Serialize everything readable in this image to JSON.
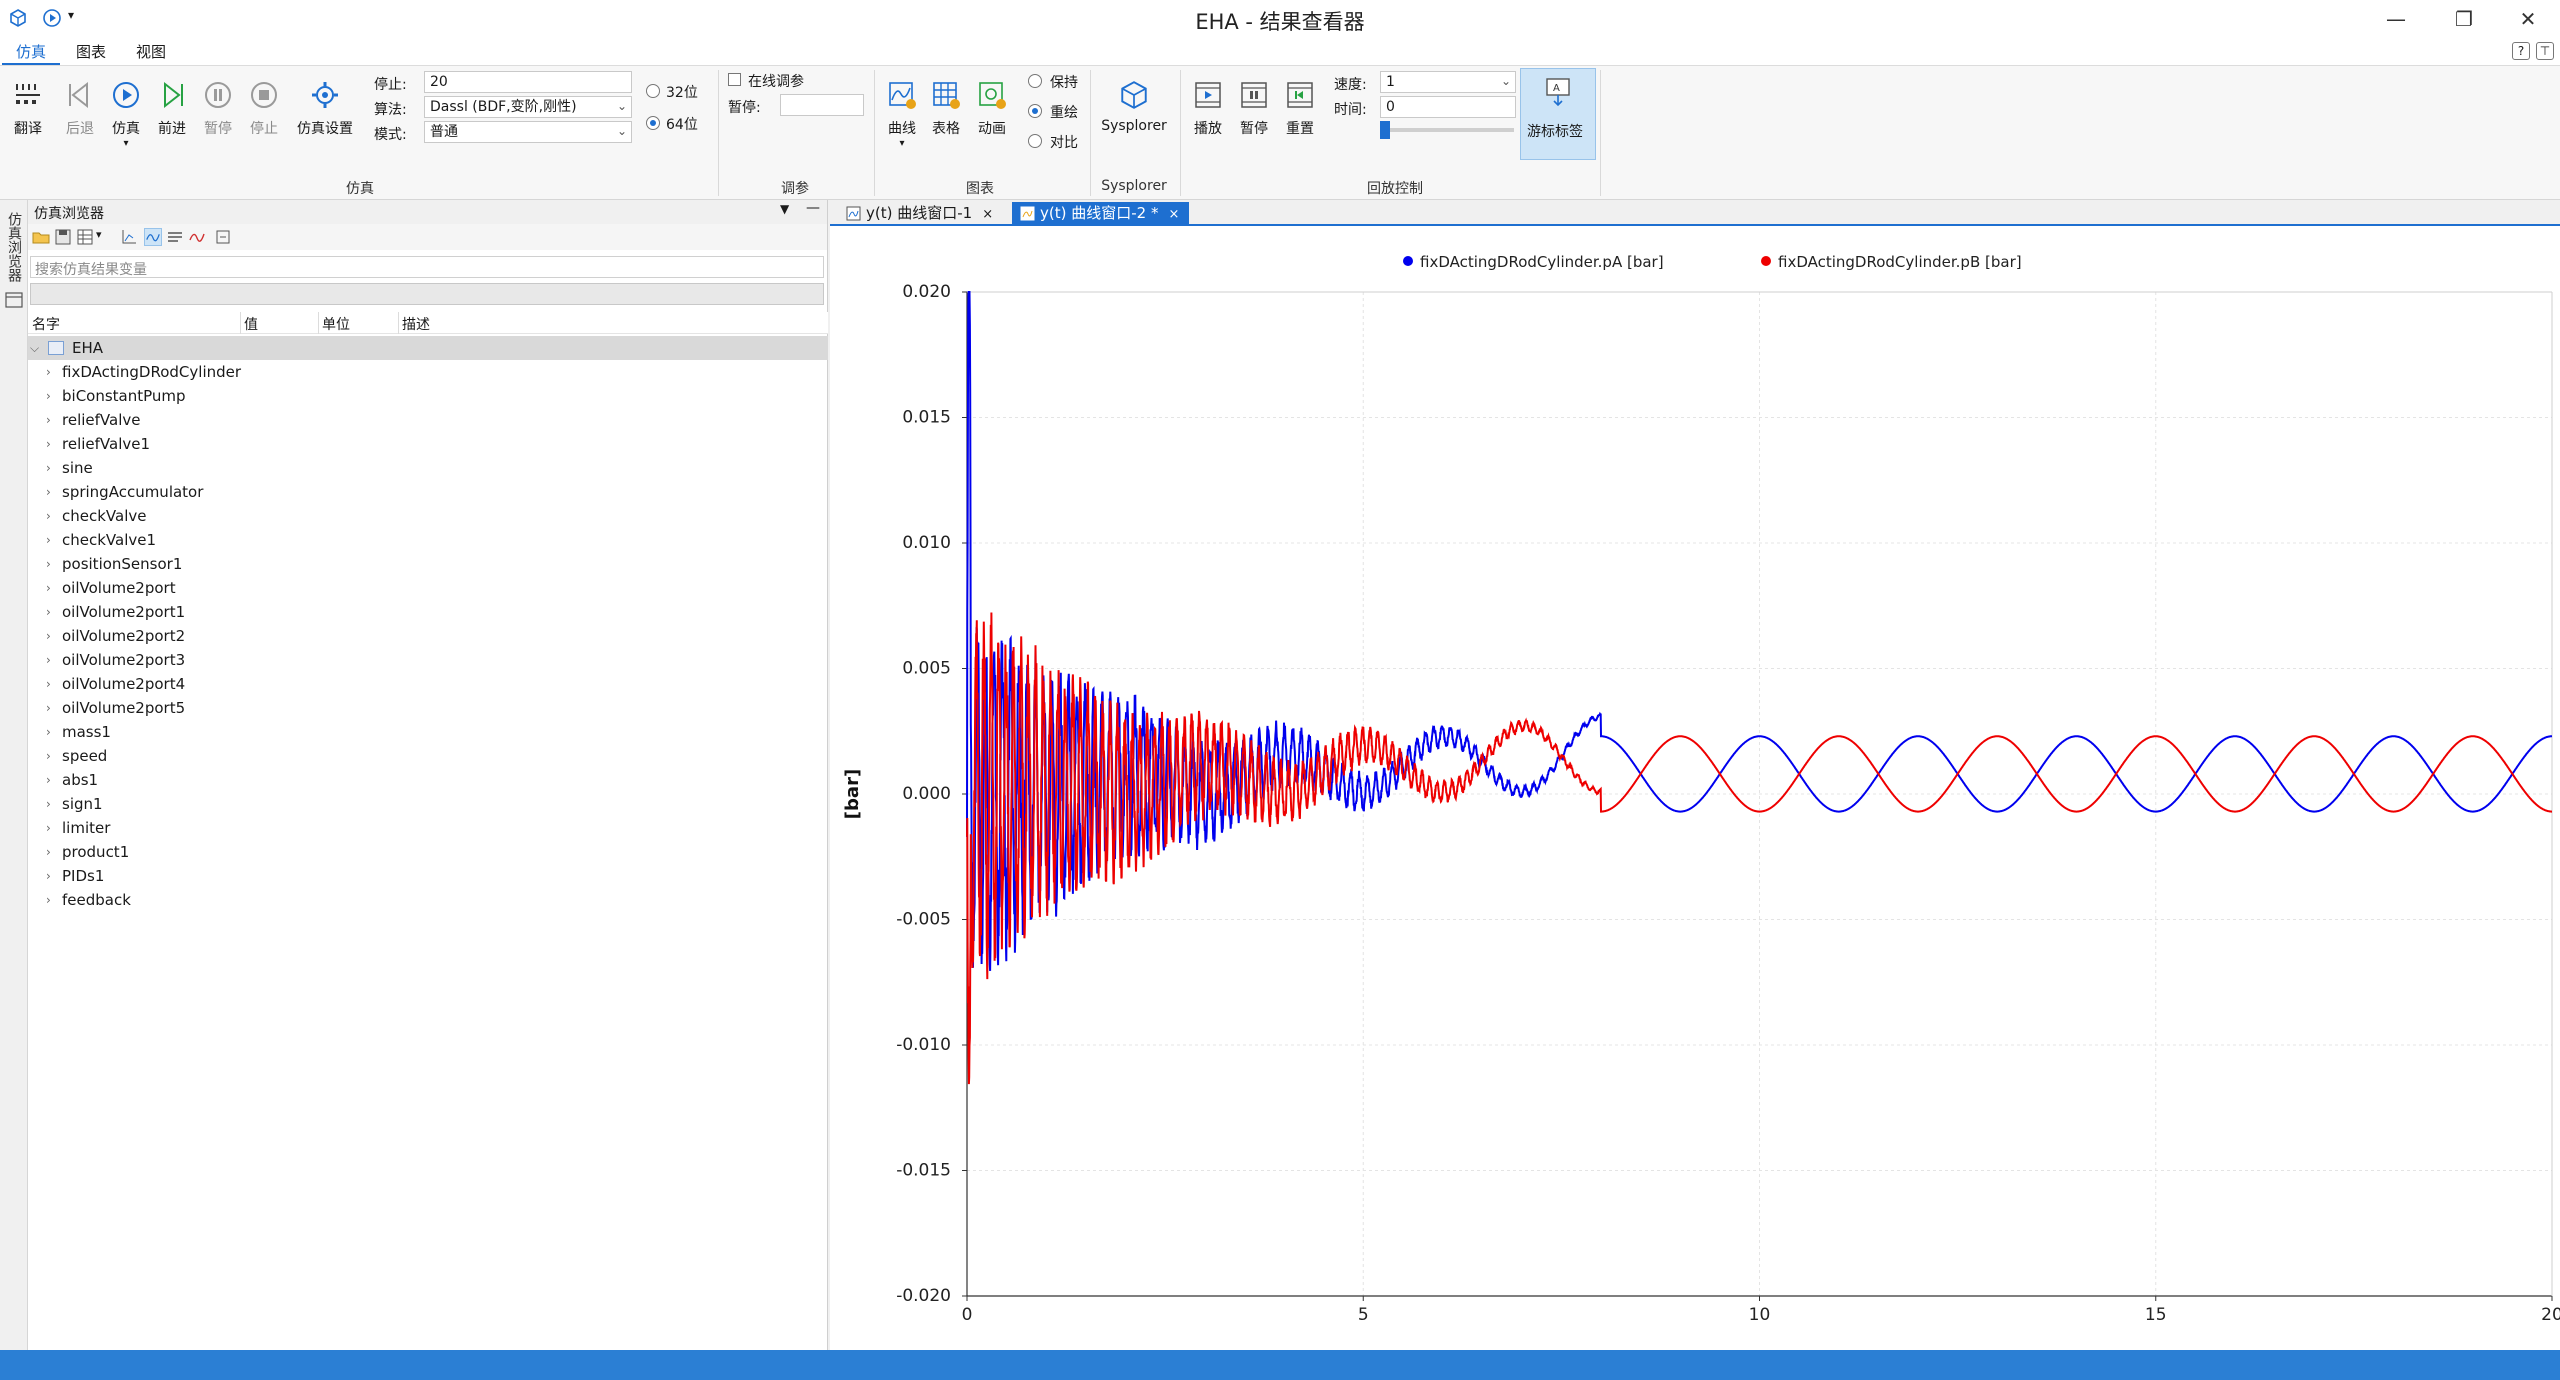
{
  "window": {
    "title": "EHA - 结果查看器",
    "controls": [
      "—",
      "❐",
      "✕"
    ]
  },
  "menu": {
    "tabs": [
      "仿真",
      "图表",
      "视图"
    ]
  },
  "ribbon": {
    "sim_buttons": [
      {
        "label": "翻译",
        "icon": "translate-icon"
      },
      {
        "label": "后退",
        "icon": "step-back-icon"
      },
      {
        "label": "仿真",
        "icon": "play-icon"
      },
      {
        "label": "前进",
        "icon": "step-forward-icon"
      },
      {
        "label": "暂停",
        "icon": "pause-icon"
      },
      {
        "label": "停止",
        "icon": "stop-icon"
      },
      {
        "label": "仿真设置",
        "icon": "settings-gear-icon"
      }
    ],
    "stop_label": "停止:",
    "stop_value": "20",
    "algorithm_label": "算法:",
    "algorithm_value": "Dassl (BDF,变阶,刚性)",
    "mode_label": "模式:",
    "mode_value": "普通",
    "bit32": "32位",
    "bit64": "64位",
    "group_sim": "仿真",
    "online_tune": "在线调参",
    "pause_label": "暂停:",
    "group_tune": "调参",
    "chart_buttons": [
      {
        "label": "曲线",
        "icon": "curve-icon"
      },
      {
        "label": "表格",
        "icon": "table-icon"
      },
      {
        "label": "动画",
        "icon": "animation-icon"
      }
    ],
    "radio_keep": "保持",
    "radio_redraw": "重绘",
    "radio_compare": "对比",
    "group_chart": "图表",
    "sysplorer_label": "Sysplorer",
    "group_sysplorer": "Sysplorer",
    "playback_buttons": [
      {
        "label": "播放",
        "icon": "play-film-icon"
      },
      {
        "label": "暂停",
        "icon": "pause-film-icon"
      },
      {
        "label": "重置",
        "icon": "reset-film-icon"
      }
    ],
    "speed_label": "速度:",
    "speed_value": "1",
    "time_label": "时间:",
    "time_value": "0",
    "cursor_label": "游标标签",
    "group_playback": "回放控制"
  },
  "sidebar": {
    "vertical_label": "仿真浏览器"
  },
  "browser": {
    "title": "仿真浏览器",
    "search_placeholder": "搜索仿真结果变量",
    "columns": [
      "名字",
      "值",
      "单位",
      "描述"
    ],
    "root": "EHA",
    "items": [
      "fixDActingDRodCylinder",
      "biConstantPump",
      "reliefValve",
      "reliefValve1",
      "sine",
      "springAccumulator",
      "checkValve",
      "checkValve1",
      "positionSensor1",
      "oilVolume2port",
      "oilVolume2port1",
      "oilVolume2port2",
      "oilVolume2port3",
      "oilVolume2port4",
      "oilVolume2port5",
      "mass1",
      "speed",
      "abs1",
      "sign1",
      "limiter",
      "product1",
      "PIDs1",
      "feedback"
    ]
  },
  "plot": {
    "tabs": [
      {
        "label": "y(t) 曲线窗口-1",
        "close": "×"
      },
      {
        "label": "y(t) 曲线窗口-2 *",
        "close": "×"
      }
    ]
  },
  "chart_data": {
    "type": "line",
    "title": "",
    "xlabel": "",
    "ylabel": "[bar]",
    "xlim": [
      0,
      20
    ],
    "ylim": [
      -0.02,
      0.02
    ],
    "xticks": [
      "0",
      "5",
      "10",
      "15",
      "20"
    ],
    "yticks": [
      "0.020",
      "0.015",
      "0.010",
      "0.005",
      "0.000",
      "-0.005",
      "-0.010",
      "-0.015",
      "-0.020"
    ],
    "grid": true,
    "legend_position": "top",
    "series": [
      {
        "name": "fixDActingDRodCylinder.pA [bar]",
        "color": "#0000ee",
        "steady_amplitude": 0.0015,
        "steady_offset": 0.0008,
        "period": 2.0,
        "phase": 0.0
      },
      {
        "name": "fixDActingDRodCylinder.pB [bar]",
        "color": "#ee0000",
        "steady_amplitude": 0.0015,
        "steady_offset": 0.0008,
        "period": 2.0,
        "phase": 3.14159
      }
    ]
  }
}
